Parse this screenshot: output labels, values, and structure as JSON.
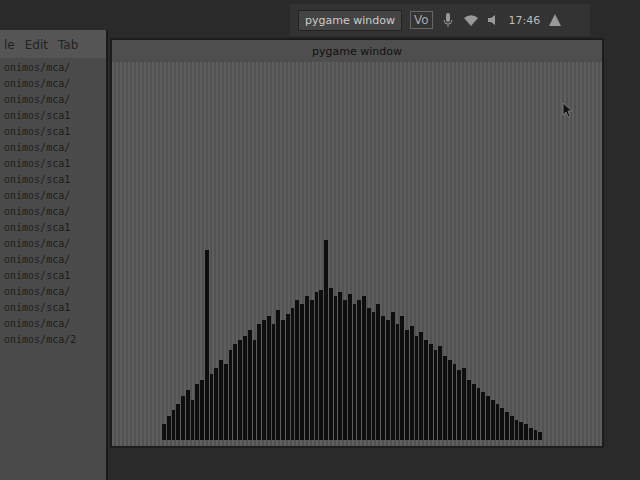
{
  "panel": {
    "task": "pygame window",
    "tray": [
      "Vo"
    ],
    "clock": "17:46"
  },
  "terminal": {
    "menu": [
      "le",
      "Edit",
      "Tab"
    ],
    "lines": [
      "onimos/mca/",
      "onimos/mca/",
      "onimos/mca/",
      "onimos/sca1",
      "onimos/sca1",
      "onimos/mca/",
      "onimos/sca1",
      "onimos/sca1",
      "onimos/mca/",
      "onimos/mca/",
      "onimos/sca1",
      "onimos/mca/",
      "onimos/mca/",
      "onimos/sca1",
      "onimos/mca/",
      "onimos/sca1",
      "onimos/mca/",
      "onimos/mca/2"
    ]
  },
  "window": {
    "title": "pygame window"
  },
  "chart": {
    "values": [
      8,
      12,
      15,
      18,
      22,
      25,
      20,
      28,
      30,
      95,
      33,
      36,
      40,
      38,
      45,
      48,
      50,
      52,
      55,
      50,
      58,
      60,
      62,
      58,
      65,
      60,
      63,
      66,
      70,
      68,
      72,
      70,
      74,
      75,
      100,
      76,
      72,
      74,
      70,
      73,
      68,
      70,
      72,
      66,
      64,
      68,
      62,
      60,
      64,
      58,
      62,
      55,
      57,
      52,
      54,
      50,
      48,
      45,
      47,
      42,
      40,
      38,
      35,
      36,
      30,
      28,
      26,
      24,
      22,
      20,
      18,
      16,
      14,
      12,
      10,
      9,
      8,
      6,
      5,
      4
    ]
  }
}
